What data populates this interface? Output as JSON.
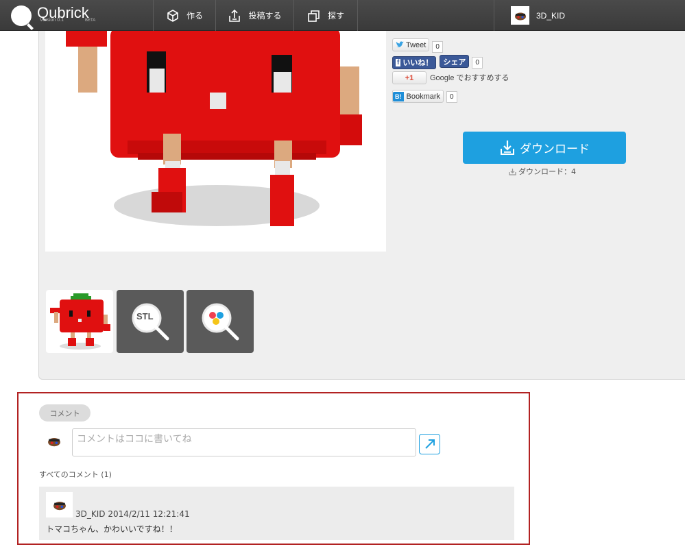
{
  "header": {
    "logo_text": "Qubrick",
    "version": "Version 0.1",
    "beta": "BETA",
    "nav": [
      {
        "label": "作る",
        "icon": "cube-icon"
      },
      {
        "label": "投稿する",
        "icon": "upload-icon"
      },
      {
        "label": "探す",
        "icon": "windows-icon"
      }
    ],
    "user_name": "3D_KID"
  },
  "social": {
    "tweet_label": "Tweet",
    "tweet_count": "0",
    "like_label": "いいね！",
    "share_label": "シェア",
    "fb_count": "0",
    "gplus_label": "+1",
    "gplus_text": "Google でおすすめする",
    "bookmark_label": "Bookmark",
    "bookmark_count": "0"
  },
  "download": {
    "button_label": "ダウンロード",
    "count_text": "ダウンロード：4"
  },
  "thumbs": {
    "stl_label": "STL"
  },
  "comments": {
    "tab_label": "コメント",
    "input_placeholder": "コメントはココに書いてね",
    "all_label": "すべてのコメント (1)",
    "items": [
      {
        "author": "3D_KID",
        "date": "2014/2/11 12:21:41",
        "text": "トマコちゃん、かわいいですね！！"
      }
    ]
  },
  "colors": {
    "accent": "#1ea0e0",
    "highlight_border": "#b22222",
    "tomato": "#e01010"
  }
}
